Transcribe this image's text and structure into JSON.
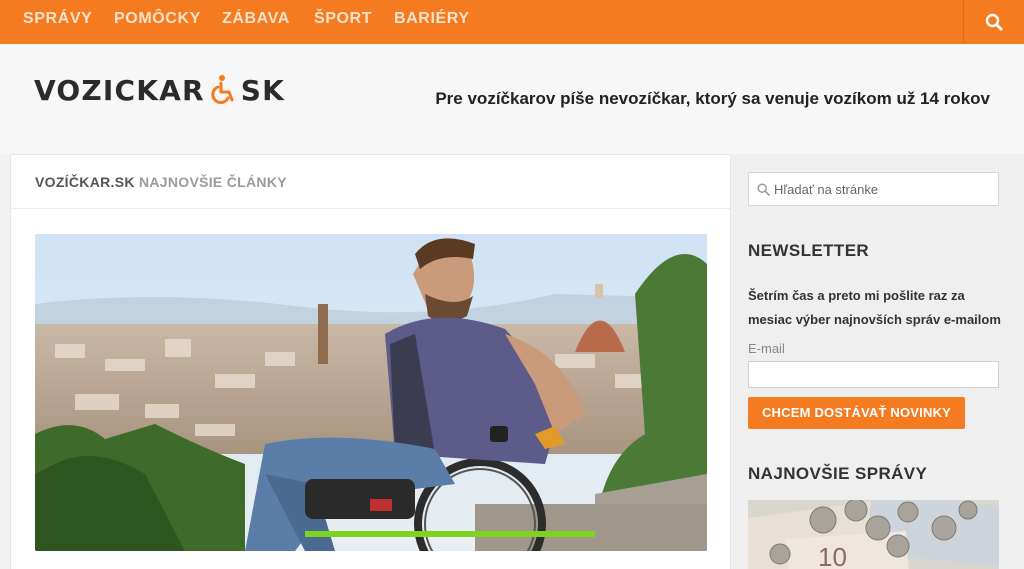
{
  "nav": {
    "items": [
      {
        "label": "SPRÁVY"
      },
      {
        "label": "POMÔCKY"
      },
      {
        "label": "ZÁBAVA"
      },
      {
        "label": "ŠPORT"
      },
      {
        "label": "BARIÉRY"
      }
    ],
    "search_icon": "search-icon"
  },
  "header": {
    "logo_left": "VOZICKAR",
    "logo_right": "SK",
    "logo_icon": "wheelchair-icon",
    "tagline": "Pre vozíčkarov píše nevozíčkar, ktorý sa venuje vozíkom už 14 rokov"
  },
  "main": {
    "heading_brand": "VOZÍČKAR.SK",
    "heading_rest": "NAJNOVŠIE ČLÁNKY"
  },
  "sidebar": {
    "search_placeholder": "Hľadať na stránke",
    "newsletter_title": "NEWSLETTER",
    "newsletter_text": "Šetrím čas a preto mi pošlite raz za mesiac výber najnovších správ e-mailom",
    "email_label": "E-mail",
    "subscribe_label": "CHCEM DOSTÁVAŤ NOVINKY",
    "latest_title": "NAJNOVŠIE SPRÁVY"
  },
  "colors": {
    "accent": "#f47b20",
    "nav_text": "#fde2cc"
  }
}
